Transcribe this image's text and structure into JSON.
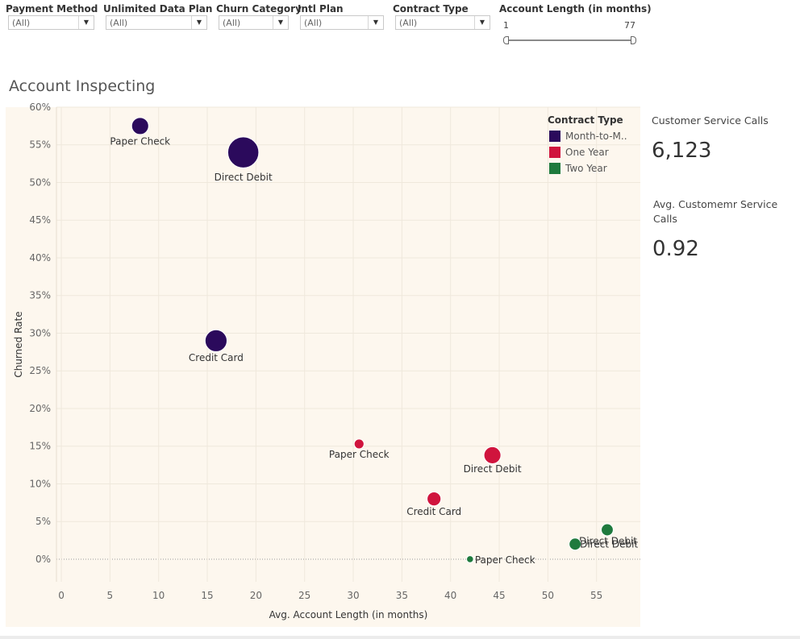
{
  "filters": [
    {
      "label": "Payment Method",
      "value": "(All)"
    },
    {
      "label": "Unlimited Data Plan",
      "value": "(All)"
    },
    {
      "label": "Churn Category",
      "value": "(All)"
    },
    {
      "label": "Intl Plan",
      "value": "(All)"
    },
    {
      "label": "Contract Type",
      "value": "(All)"
    }
  ],
  "account_length_filter": {
    "label": "Account Length (in months)",
    "min_value": "1",
    "max_value": "77"
  },
  "dashboard_title": "Account Inspecting",
  "kpis": {
    "calls_label": "Customer Service Calls",
    "calls_value": "6,123",
    "avg_label": "Avg. Customemr Service Calls",
    "avg_value": "0.92"
  },
  "colors": {
    "month_to_month": "#2b0a5c",
    "one_year": "#d0143d",
    "two_year": "#1f7a3d",
    "plot_bg": "#fdf7ee"
  },
  "chart_data": {
    "type": "scatter",
    "xlabel": "Avg. Account Length (in months)",
    "ylabel": "Churned Rate",
    "xlim": [
      -0.5,
      59.5
    ],
    "ylim": [
      -0.03,
      0.6
    ],
    "x_ticks": [
      "0",
      "5",
      "10",
      "15",
      "20",
      "25",
      "30",
      "35",
      "40",
      "45",
      "50",
      "55"
    ],
    "y_ticks": [
      "0%",
      "5%",
      "10%",
      "15%",
      "20%",
      "25%",
      "30%",
      "35%",
      "40%",
      "45%",
      "50%",
      "55%",
      "60%"
    ],
    "grid": true,
    "legend": {
      "title": "Contract Type",
      "position": "top-right"
    },
    "series": [
      {
        "name": "Month-to-M..",
        "color": "#2b0a5c",
        "points": [
          {
            "label": "Paper Check",
            "x": 8.1,
            "y": 0.575,
            "size": 6
          },
          {
            "label": "Direct Debit",
            "x": 18.7,
            "y": 0.54,
            "size": 20
          },
          {
            "label": "Credit Card",
            "x": 15.9,
            "y": 0.29,
            "size": 10
          }
        ]
      },
      {
        "name": "One Year",
        "color": "#d0143d",
        "points": [
          {
            "label": "Paper Check",
            "x": 30.6,
            "y": 0.153,
            "size": 2
          },
          {
            "label": "Direct Debit",
            "x": 44.3,
            "y": 0.138,
            "size": 6
          },
          {
            "label": "Credit Card",
            "x": 38.3,
            "y": 0.08,
            "size": 4
          }
        ]
      },
      {
        "name": "Two Year",
        "color": "#1f7a3d",
        "points": [
          {
            "label": "Paper Check",
            "x": 42.0,
            "y": 0.0,
            "size": 1
          },
          {
            "label": "Direct Debit",
            "x": 56.1,
            "y": 0.039,
            "size": 3
          },
          {
            "label": "Direct Debit",
            "x": 52.8,
            "y": 0.02,
            "size": 3
          }
        ]
      }
    ]
  }
}
